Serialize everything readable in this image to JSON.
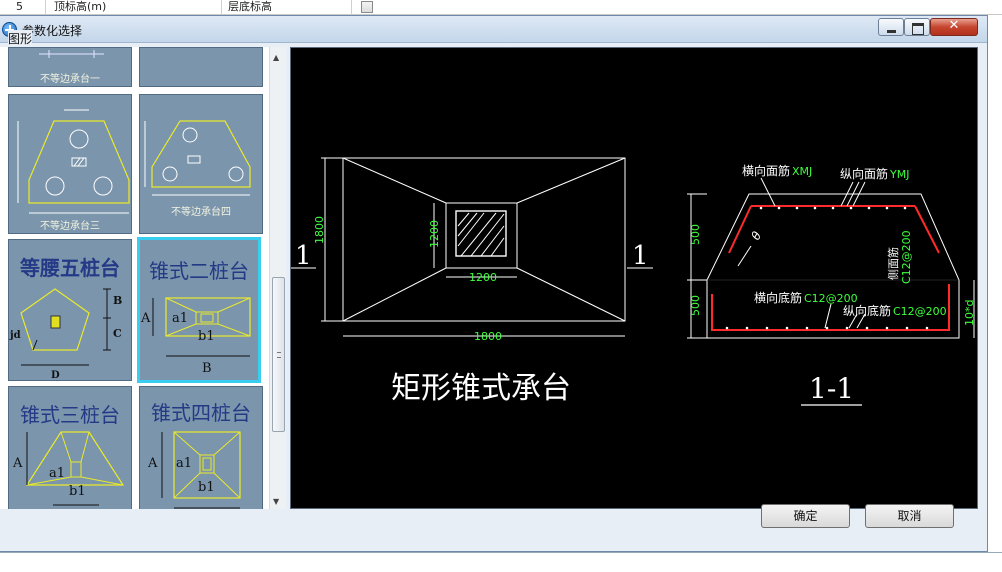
{
  "background_table": {
    "row_number": "5",
    "col1": "顶标高(m)",
    "col2": "层底标高"
  },
  "dialog": {
    "title": "参数化选择",
    "group_label": "图形"
  },
  "tiles": {
    "t0": "不等边承台一",
    "t1": "不等边承台三",
    "t2": "不等边承台四",
    "t3_title": "等腰五桩台",
    "t4_title": "锥式二桩台",
    "t5_title": "锥式三桩台",
    "t6_title": "锥式四桩台",
    "labels": {
      "B": "B",
      "C": "C",
      "D": "D",
      "jd": "jd",
      "A": "A",
      "a1": "a1",
      "b1": "b1"
    }
  },
  "preview": {
    "plan_caption": "矩形锥式承台",
    "section_caption": "1-1",
    "section_mark": "1",
    "dim_1800": "1800",
    "dim_1200": "1200",
    "dim_500": "500",
    "h_top_rebar_label": "横向面筋",
    "h_top_rebar_value": "XMJ",
    "v_top_rebar_label": "纵向面筋",
    "v_top_rebar_value": "YMJ",
    "side_rebar_label": "侧面筋",
    "side_rebar_value": "C12@200",
    "h_bot_rebar_label": "横向底筋",
    "h_bot_rebar_value": "C12@200",
    "v_bot_rebar_label": "纵向底筋",
    "v_bot_rebar_value": "C12@200",
    "theta": "θ",
    "cover": "10*d"
  },
  "buttons": {
    "ok": "确定",
    "cancel": "取消"
  },
  "icons": [
    "app-icon",
    "minimize-icon",
    "maximize-icon",
    "close-icon",
    "scroll-up-icon",
    "scroll-down-icon"
  ]
}
